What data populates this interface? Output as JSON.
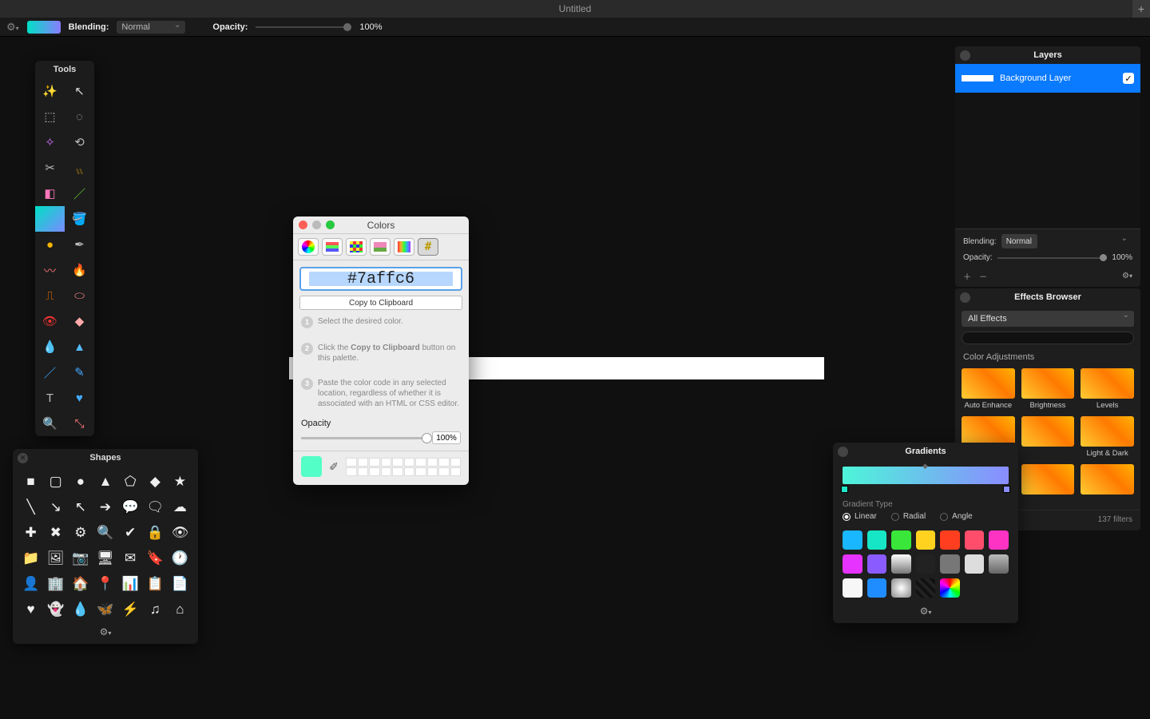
{
  "window": {
    "title": "Untitled"
  },
  "optionsbar": {
    "blending_label": "Blending:",
    "blending_value": "Normal",
    "opacity_label": "Opacity:",
    "opacity_value": "100%"
  },
  "tools": {
    "title": "Tools"
  },
  "shapes": {
    "title": "Shapes"
  },
  "colors": {
    "title": "Colors",
    "hex": "#7affc6",
    "copy_button": "Copy to Clipboard",
    "step1": "Select the desired color.",
    "step2_pre": "Click the ",
    "step2_bold": "Copy to Clipboard",
    "step2_post": " button on this palette.",
    "step3": "Paste the color code in any selected location, regardless of whether it is associated with an HTML or CSS editor.",
    "opacity_label": "Opacity",
    "opacity_value": "100%",
    "current_swatch": "#53ffc6"
  },
  "layers": {
    "title": "Layers",
    "layer_name": "Background Layer",
    "blending_label": "Blending:",
    "blending_value": "Normal",
    "opacity_label": "Opacity:",
    "opacity_value": "100%"
  },
  "effects": {
    "title": "Effects Browser",
    "filter": "All Effects",
    "section": "Color Adjustments",
    "items": [
      "Auto Enhance",
      "Brightness",
      "Levels",
      "",
      "",
      "Light & Dark",
      "",
      "",
      ""
    ],
    "footer": "137 filters"
  },
  "gradients": {
    "title": "Gradients",
    "type_label": "Gradient Type",
    "types": [
      "Linear",
      "Radial",
      "Angle"
    ],
    "selected_type": "Linear",
    "stop_left": "#1fe6c8",
    "stop_right": "#8a8cff",
    "swatches": [
      "#18b7ff",
      "#16e6c5",
      "#39e639",
      "#ffd21f",
      "#ff3e1f",
      "#ff4d6b",
      "#ff33c3",
      "#e633ff",
      "#8a5bff",
      "linear-gradient(#fff,#777)",
      "#222",
      "#777",
      "#ddd",
      "linear-gradient(#bbb,#666)",
      "#f7f7f7",
      "#1f8dff",
      "radial-gradient(circle,#fff,#888)",
      "repeating-linear-gradient(45deg,#222 0 4px,#111 4px 8px)",
      "conic-gradient(red,yellow,lime,cyan,blue,magenta,red)"
    ]
  }
}
